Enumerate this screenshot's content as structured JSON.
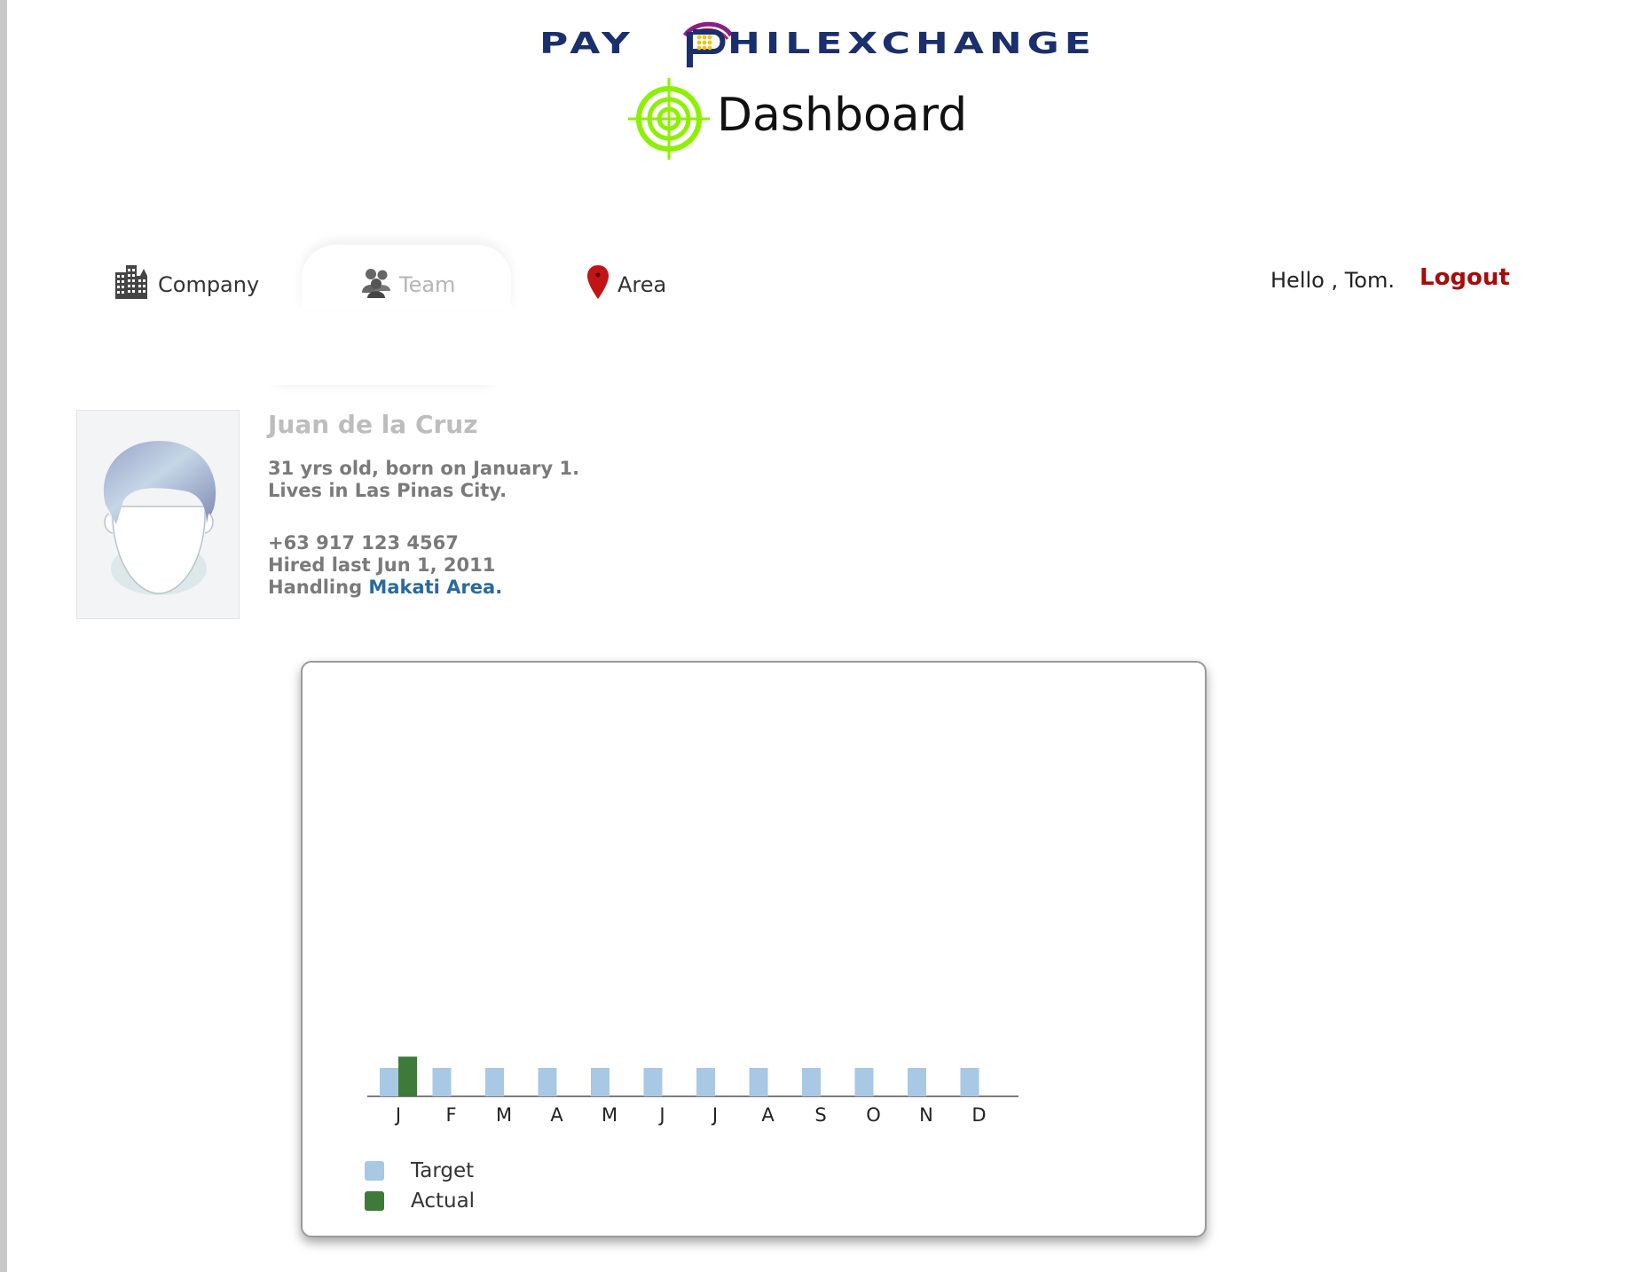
{
  "brand": {
    "part1": "PAY",
    "part2": "HILEXCHANGE"
  },
  "header": {
    "title": "Dashboard"
  },
  "nav": {
    "items": [
      {
        "label": "Company",
        "icon": "buildings-icon"
      },
      {
        "label": "Team",
        "icon": "people-icon",
        "active": true
      },
      {
        "label": "Area",
        "icon": "map-pin-icon"
      }
    ]
  },
  "user": {
    "greeting": "Hello , Tom.",
    "logout_label": "Logout"
  },
  "profile": {
    "name": "Juan de la Cruz",
    "age_line": "31 yrs old, born on January 1.",
    "location_line": "Lives in Las Pinas City.",
    "phone": "+63 917 123 4567",
    "hired_line": "Hired last Jun 1, 2011",
    "handling_prefix": "Handling ",
    "handling_area": "Makati Area."
  },
  "colors": {
    "target": "#a8c8e4",
    "actual": "#3e7a3a",
    "logout": "#a80b0b",
    "link": "#2b6a9b",
    "target_icon": "#8cf000"
  },
  "chart_data": {
    "type": "bar",
    "categories": [
      "J",
      "F",
      "M",
      "A",
      "M",
      "J",
      "J",
      "A",
      "S",
      "O",
      "N",
      "D"
    ],
    "series": [
      {
        "name": "Target",
        "values": [
          1,
          1,
          1,
          1,
          1,
          1,
          1,
          1,
          1,
          1,
          1,
          1
        ]
      },
      {
        "name": "Actual",
        "values": [
          1.4,
          null,
          null,
          null,
          null,
          null,
          null,
          null,
          null,
          null,
          null,
          null
        ]
      }
    ],
    "ylim": [
      0,
      1.5
    ],
    "grid": false,
    "legend": "bottom-left"
  }
}
